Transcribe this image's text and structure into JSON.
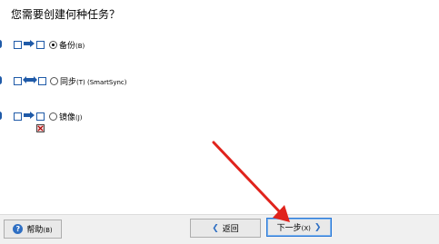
{
  "question": "您需要创建何种任务？",
  "options": [
    {
      "label": "备份",
      "key": "(B)",
      "selected": true
    },
    {
      "label": "同步",
      "key": "(T) (SmartSync)",
      "selected": false
    },
    {
      "label": "镜像",
      "key": "(J)",
      "selected": false
    }
  ],
  "footer": {
    "help_label": "帮助",
    "help_key": "(B)",
    "back_label": "返回",
    "next_label": "下一步",
    "next_key": "(X)"
  },
  "colors": {
    "accent": "#1f5aa8",
    "annotation": "#e0231c"
  },
  "icons": {
    "help": "help-icon",
    "back": "chevron-left-icon",
    "next": "chevron-right-icon"
  }
}
